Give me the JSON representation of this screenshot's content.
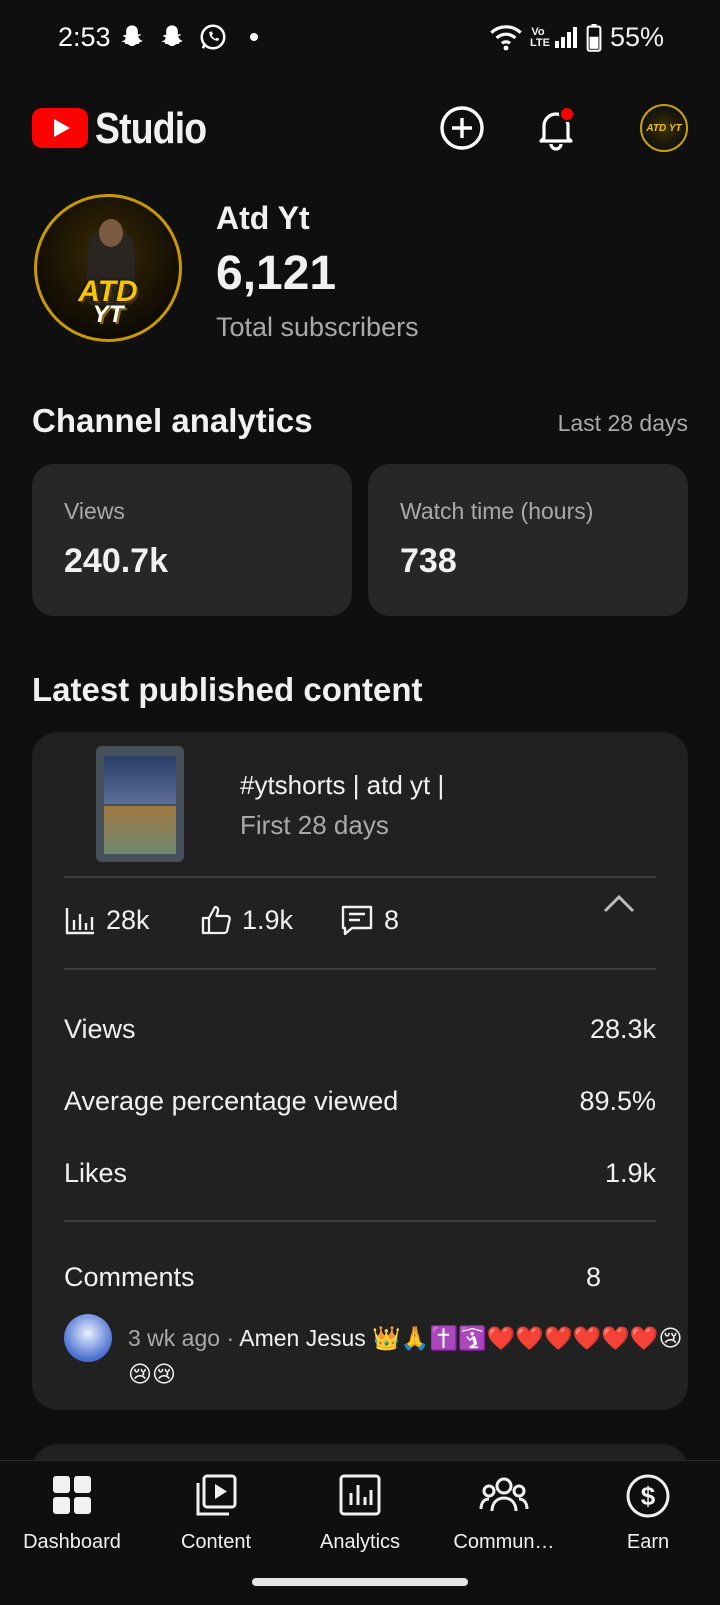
{
  "status_bar": {
    "time": "2:53",
    "battery": "55%",
    "network": "Vo LTE"
  },
  "header": {
    "app_name": "Studio",
    "avatar_text": "ATD YT"
  },
  "channel": {
    "name": "Atd Yt",
    "subscribers": "6,121",
    "subscribers_label": "Total subscribers",
    "avatar_line1": "ATD",
    "avatar_line2": "YT"
  },
  "analytics": {
    "title": "Channel analytics",
    "range": "Last 28 days",
    "cards": [
      {
        "label": "Views",
        "value": "240.7k"
      },
      {
        "label": "Watch time (hours)",
        "value": "738"
      }
    ]
  },
  "latest": {
    "title": "Latest published content",
    "video_title": "#ytshorts | atd yt |",
    "period": "First 28 days",
    "stats": {
      "views": "28k",
      "likes": "1.9k",
      "comments": "8"
    },
    "rows": [
      {
        "label": "Views",
        "value": "28.3k"
      },
      {
        "label": "Average percentage viewed",
        "value": "89.5%"
      },
      {
        "label": "Likes",
        "value": "1.9k"
      }
    ],
    "comments_label": "Comments",
    "comments_value": "8",
    "comment": {
      "time": "3 wk ago · ",
      "text": "Amen Jesus 👑🙏✝️🛐❤️❤️❤️❤️❤️❤️😢😢😢"
    }
  },
  "nav": [
    {
      "label": "Dashboard",
      "icon": "dashboard-icon"
    },
    {
      "label": "Content",
      "icon": "content-icon"
    },
    {
      "label": "Analytics",
      "icon": "analytics-icon"
    },
    {
      "label": "Commun…",
      "icon": "community-icon"
    },
    {
      "label": "Earn",
      "icon": "earn-icon"
    }
  ],
  "colors": {
    "background": "#0f0f0f",
    "card": "#272727",
    "accent_red": "#ff0000",
    "secondary_text": "#aaaaaa"
  }
}
